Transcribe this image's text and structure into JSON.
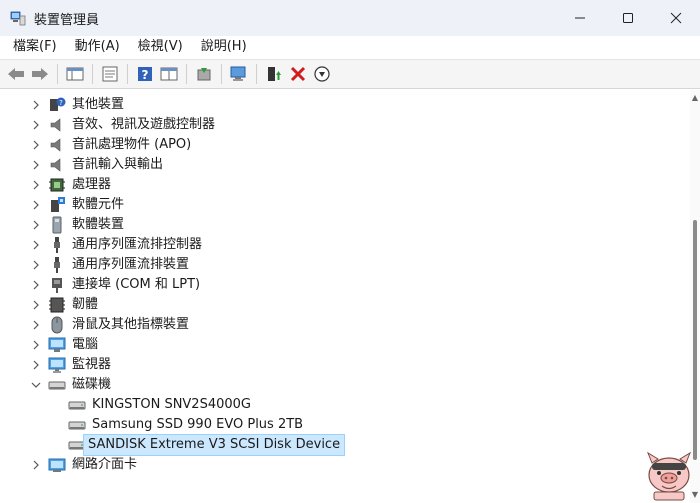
{
  "window": {
    "title": "裝置管理員",
    "icon": "device-manager-icon"
  },
  "menu": [
    "檔案(F)",
    "動作(A)",
    "檢視(V)",
    "說明(H)"
  ],
  "toolbar": {
    "buttons": [
      "back-icon",
      "forward-icon",
      "show-hide-tree-icon",
      "properties-icon",
      "help-icon",
      "view-icon",
      "update-driver-icon",
      "scan-hardware-icon",
      "enable-device-icon",
      "uninstall-icon",
      "disable-icon"
    ]
  },
  "tree": {
    "items": [
      {
        "label": "其他裝置",
        "icon": "unknown-device-icon",
        "expanded": false,
        "level": 0
      },
      {
        "label": "音效、視訊及遊戲控制器",
        "icon": "speaker-icon",
        "expanded": false,
        "level": 0
      },
      {
        "label": "音訊處理物件 (APO)",
        "icon": "speaker-icon",
        "expanded": false,
        "level": 0
      },
      {
        "label": "音訊輸入與輸出",
        "icon": "speaker-icon",
        "expanded": false,
        "level": 0
      },
      {
        "label": "處理器",
        "icon": "processor-icon",
        "expanded": false,
        "level": 0
      },
      {
        "label": "軟體元件",
        "icon": "software-component-icon",
        "expanded": false,
        "level": 0
      },
      {
        "label": "軟體裝置",
        "icon": "software-device-icon",
        "expanded": false,
        "level": 0
      },
      {
        "label": "通用序列匯流排控制器",
        "icon": "usb-icon",
        "expanded": false,
        "level": 0
      },
      {
        "label": "通用序列匯流排裝置",
        "icon": "usb-icon",
        "expanded": false,
        "level": 0
      },
      {
        "label": "連接埠 (COM 和 LPT)",
        "icon": "port-icon",
        "expanded": false,
        "level": 0
      },
      {
        "label": "韌體",
        "icon": "firmware-icon",
        "expanded": false,
        "level": 0
      },
      {
        "label": "滑鼠及其他指標裝置",
        "icon": "mouse-icon",
        "expanded": false,
        "level": 0
      },
      {
        "label": "電腦",
        "icon": "computer-icon",
        "expanded": false,
        "level": 0
      },
      {
        "label": "監視器",
        "icon": "monitor-icon",
        "expanded": false,
        "level": 0
      },
      {
        "label": "磁碟機",
        "icon": "disk-drive-icon",
        "expanded": true,
        "level": 0
      },
      {
        "label": "KINGSTON SNV2S4000G",
        "icon": "disk-icon",
        "level": 1
      },
      {
        "label": "Samsung SSD 990 EVO Plus 2TB",
        "icon": "disk-icon",
        "level": 1
      },
      {
        "label": "SANDISK Extreme V3 SCSI Disk Device",
        "icon": "disk-icon",
        "level": 1,
        "selected": true
      },
      {
        "label": "網路介面卡",
        "icon": "network-adapter-icon",
        "expanded": false,
        "level": 0
      }
    ]
  },
  "colors": {
    "selection": "#cce8ff",
    "titlebar": "#eef2f8",
    "uninstall_red": "#d01c1c"
  }
}
